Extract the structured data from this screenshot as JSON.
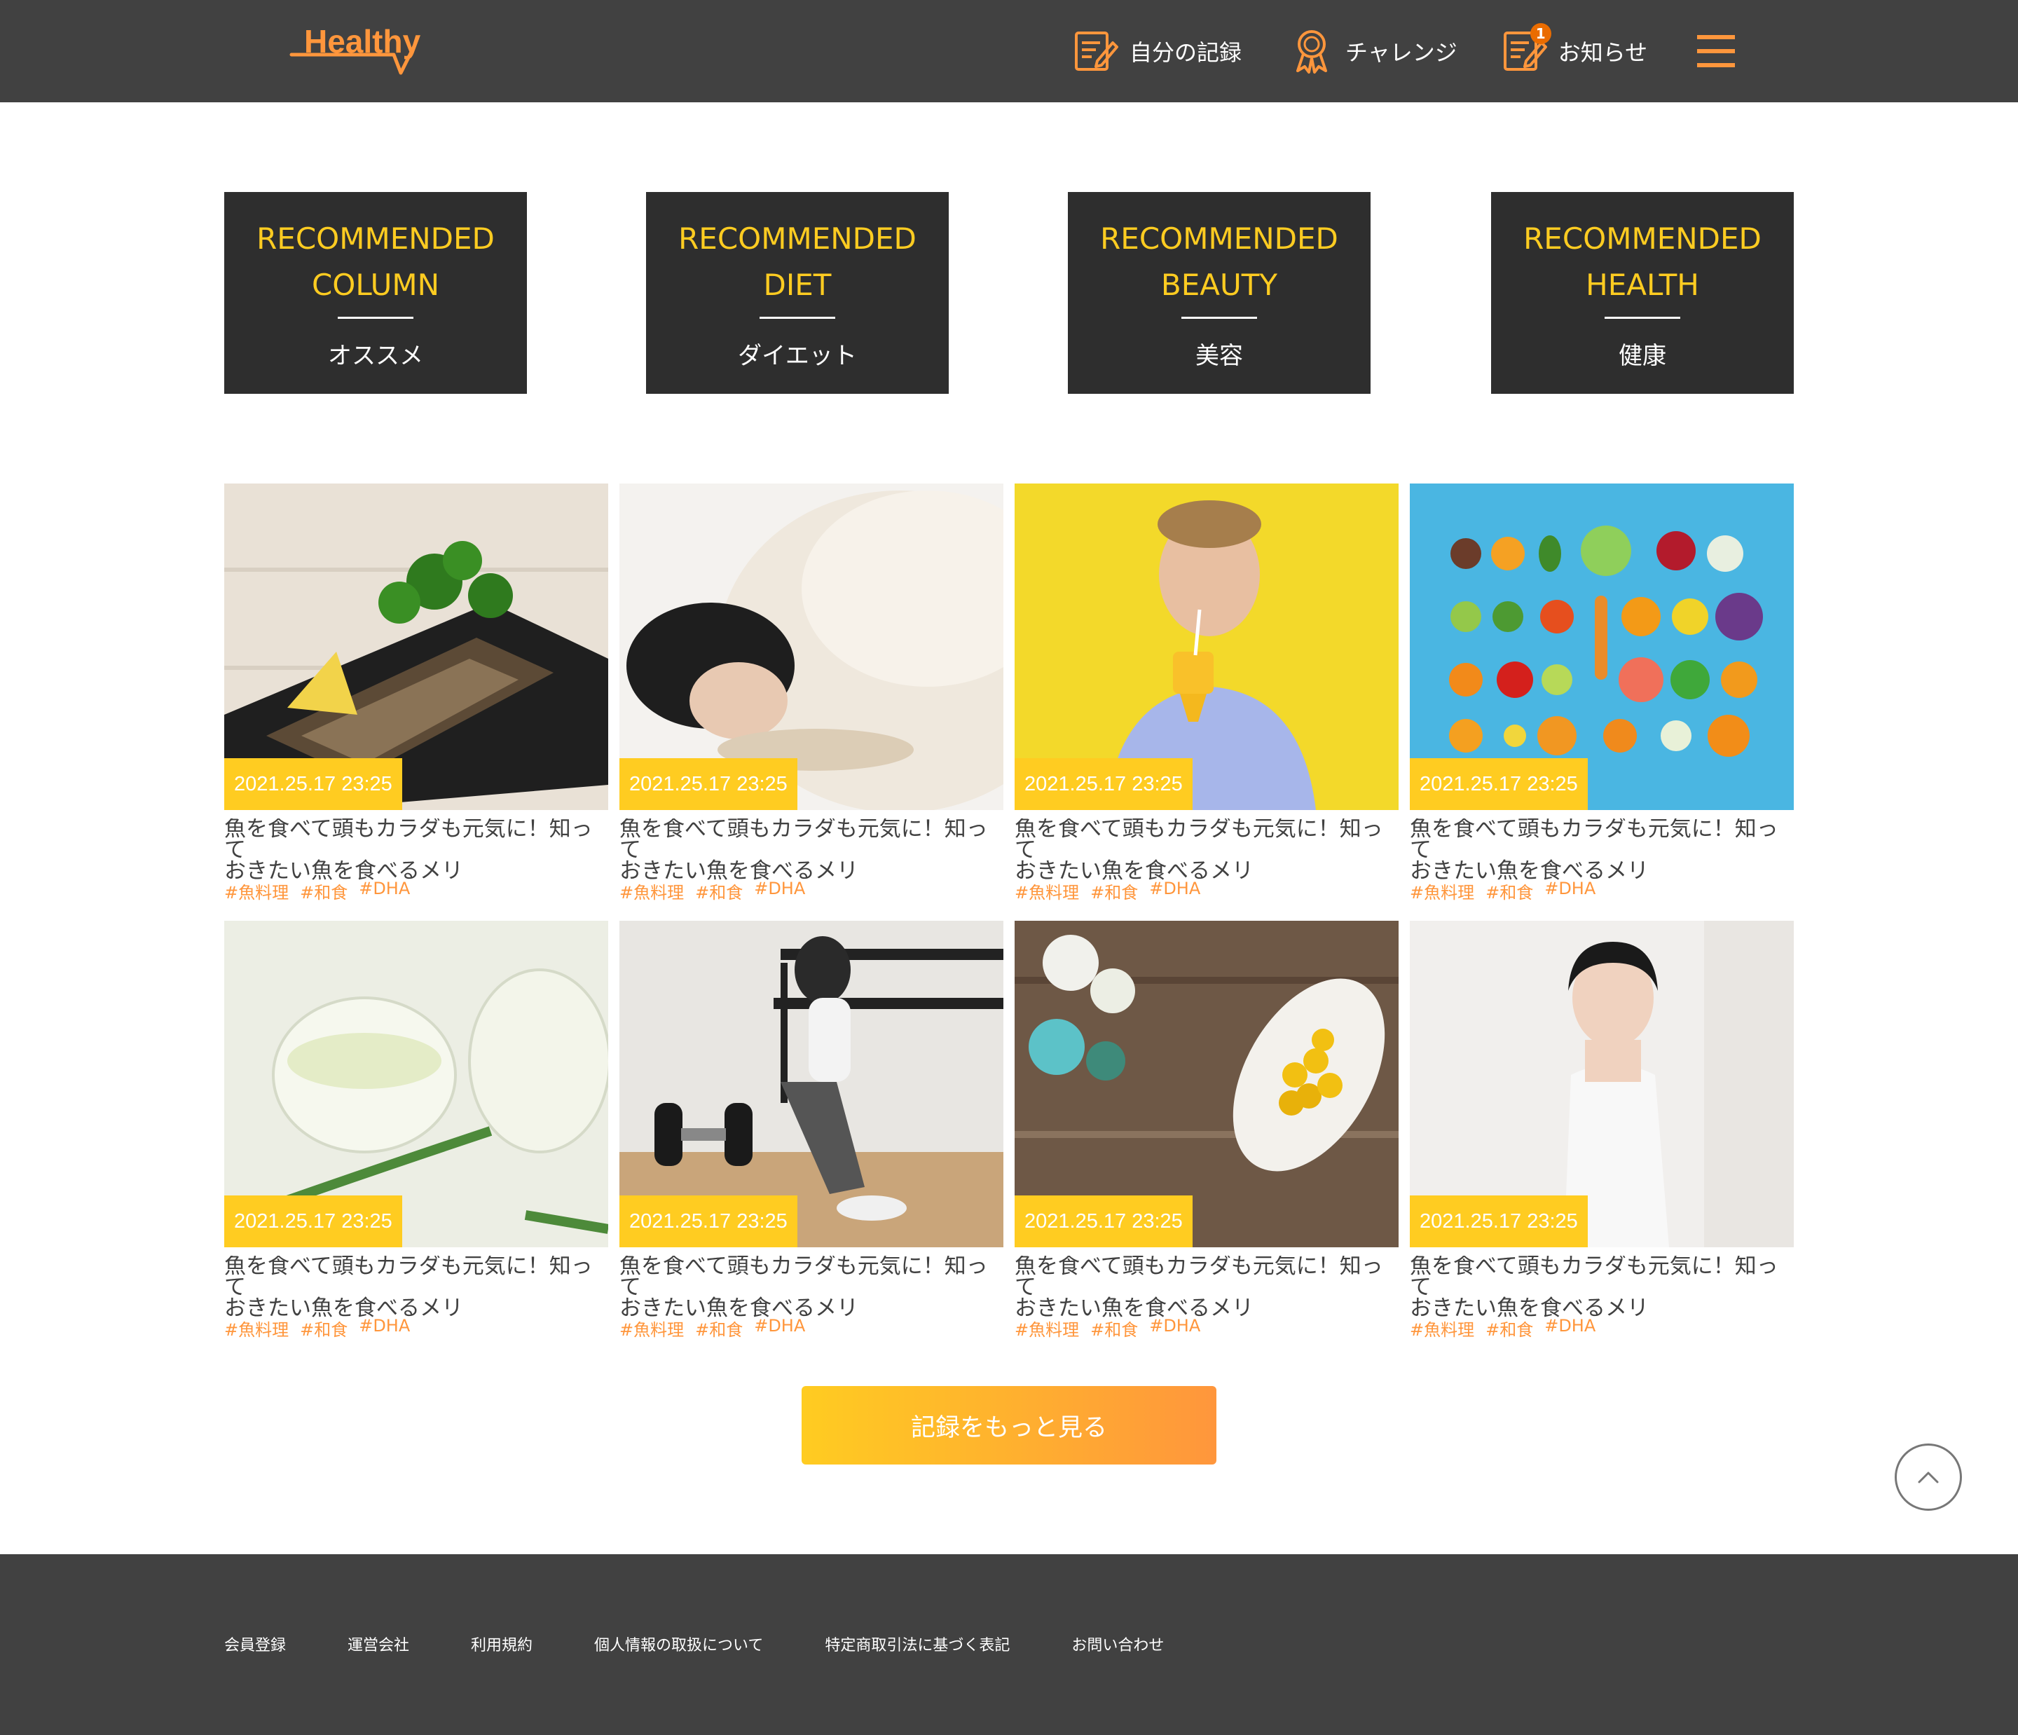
{
  "header": {
    "logo_text": "Healthy",
    "nav": [
      {
        "label": "自分の記録",
        "icon": "memo-icon"
      },
      {
        "label": "チャレンジ",
        "icon": "medal-icon"
      },
      {
        "label": "お知らせ",
        "icon": "info-icon",
        "badge": "1"
      }
    ],
    "menu_icon": "hamburger-menu-icon"
  },
  "categories": [
    {
      "title": "RECOMMENDED\nCOLUMN",
      "subtitle": "オススメ"
    },
    {
      "title": "RECOMMENDED\nDIET",
      "subtitle": "ダイエット"
    },
    {
      "title": "RECOMMENDED\nBEAUTY",
      "subtitle": "美容"
    },
    {
      "title": "RECOMMENDED\nHEALTH",
      "subtitle": "健康"
    }
  ],
  "articles": [
    {
      "date": "2021.25.17 23:25",
      "title": "魚を食べて頭もカラダも元気に！知って\nおきたい魚を食べるメリ",
      "tags": [
        "#魚料理",
        "#和食",
        "#DHA"
      ],
      "image": "grilled-fish"
    },
    {
      "date": "2021.25.17 23:25",
      "title": "魚を食べて頭もカラダも元気に！知って\nおきたい魚を食べるメリ",
      "tags": [
        "#魚料理",
        "#和食",
        "#DHA"
      ],
      "image": "sleeping-woman"
    },
    {
      "date": "2021.25.17 23:25",
      "title": "魚を食べて頭もカラダも元気に！知って\nおきたい魚を食べるメリ",
      "tags": [
        "#魚料理",
        "#和食",
        "#DHA"
      ],
      "image": "man-drinking-juice"
    },
    {
      "date": "2021.25.17 23:25",
      "title": "魚を食べて頭もカラダも元気に！知って\nおきたい魚を食べるメリ",
      "tags": [
        "#魚料理",
        "#和食",
        "#DHA"
      ],
      "image": "fruits-vegetables"
    },
    {
      "date": "2021.25.17 23:25",
      "title": "魚を食べて頭もカラダも元気に！知って\nおきたい魚を食べるメリ",
      "tags": [
        "#魚料理",
        "#和食",
        "#DHA"
      ],
      "image": "herbal-tea"
    },
    {
      "date": "2021.25.17 23:25",
      "title": "魚を食べて頭もカラダも元気に！知って\nおきたい魚を食べるメリ",
      "tags": [
        "#魚料理",
        "#和食",
        "#DHA"
      ],
      "image": "woman-gym-dumbbells"
    },
    {
      "date": "2021.25.17 23:25",
      "title": "魚を食べて頭もカラダも元気に！知って\nおきたい魚を食べるメリ",
      "tags": [
        "#魚料理",
        "#和食",
        "#DHA"
      ],
      "image": "supplement-capsules"
    },
    {
      "date": "2021.25.17 23:25",
      "title": "魚を食べて頭もカラダも元気に！知って\nおきたい魚を食べるメリ",
      "tags": [
        "#魚料理",
        "#和食",
        "#DHA"
      ],
      "image": "smiling-woman"
    }
  ],
  "more_button": "記録をもっと見る",
  "scroll_top_icon": "chevron-up-icon",
  "footer": {
    "links": [
      "会員登録",
      "運営会社",
      "利用規約",
      "個人情報の取扱について",
      "特定商取引法に基づく表記",
      "お問い合わせ"
    ]
  },
  "colors": {
    "dark": "#414141",
    "tile": "#2e2e2e",
    "primary": "#ffcc21",
    "accent": "#ff963c",
    "badge": "#ea6c00"
  }
}
